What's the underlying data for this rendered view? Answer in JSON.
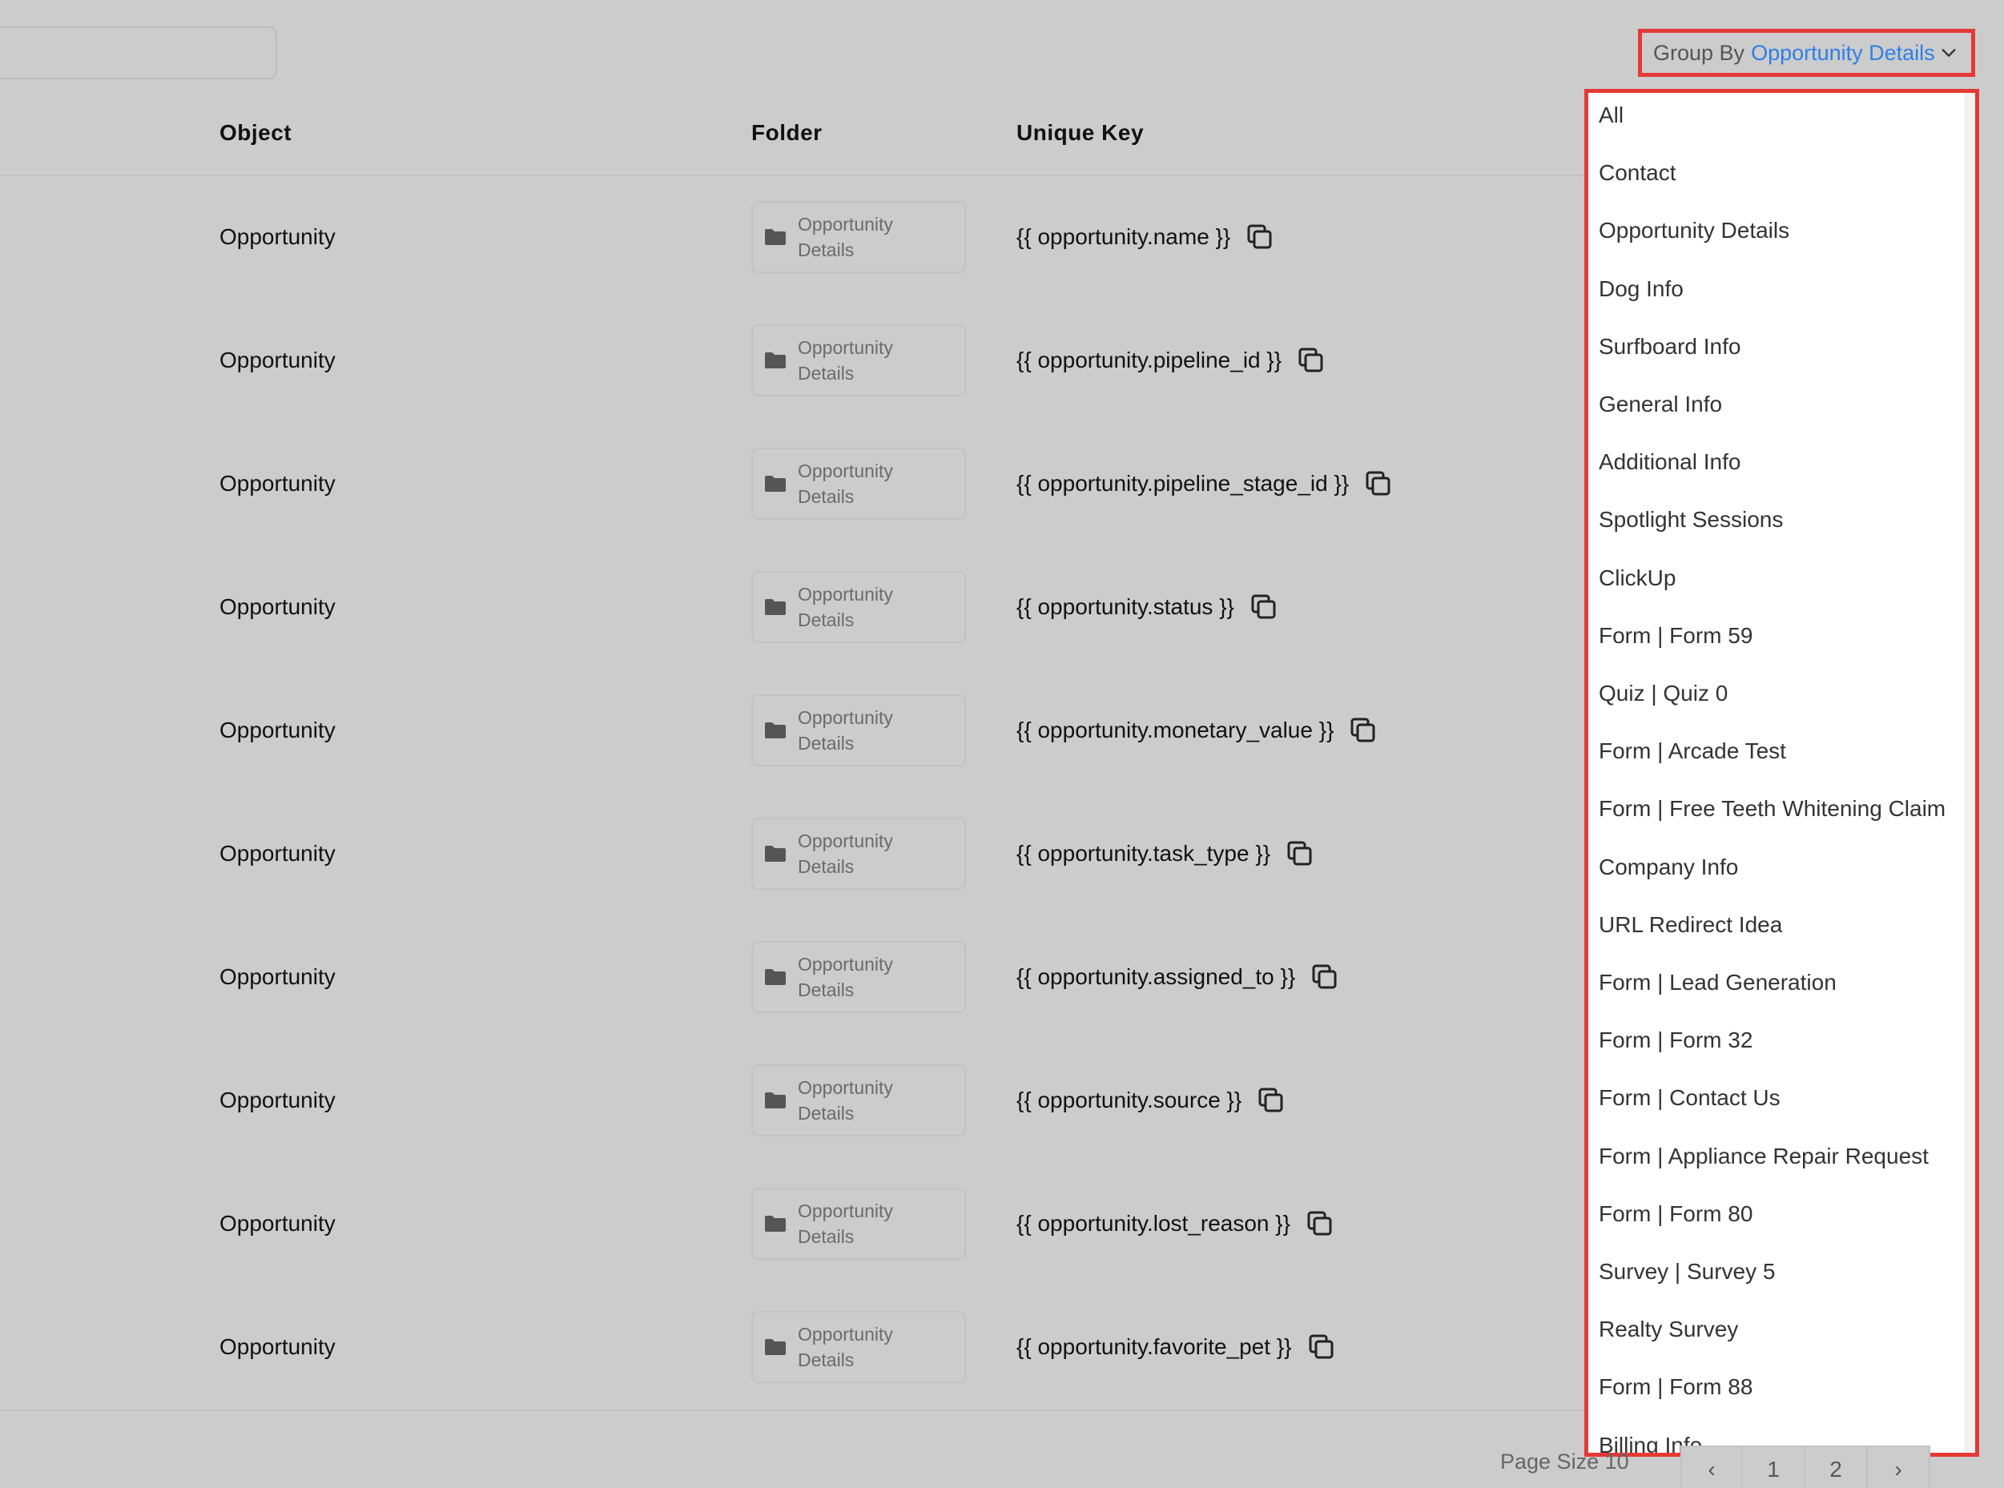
{
  "group_by": {
    "label": "Group By",
    "value": "Opportunity Details"
  },
  "table": {
    "headers": {
      "object": "Object",
      "folder": "Folder",
      "unique_key": "Unique Key"
    },
    "rows": [
      {
        "object": "Opportunity",
        "folder": "Opportunity Details",
        "key": "{{ opportunity.name }}"
      },
      {
        "object": "Opportunity",
        "folder": "Opportunity Details",
        "key": "{{ opportunity.pipeline_id }}"
      },
      {
        "object": "Opportunity",
        "folder": "Opportunity Details",
        "key": "{{ opportunity.pipeline_stage_id }}"
      },
      {
        "object": "Opportunity",
        "folder": "Opportunity Details",
        "key": "{{ opportunity.status }}"
      },
      {
        "object": "Opportunity",
        "folder": "Opportunity Details",
        "key": "{{ opportunity.monetary_value }}"
      },
      {
        "object": "Opportunity",
        "folder": "Opportunity Details",
        "key": "{{ opportunity.task_type }}"
      },
      {
        "object": "Opportunity",
        "folder": "Opportunity Details",
        "key": "{{ opportunity.assigned_to }}"
      },
      {
        "object": "Opportunity",
        "folder": "Opportunity Details",
        "key": "{{ opportunity.source }}"
      },
      {
        "object": "Opportunity",
        "folder": "Opportunity Details",
        "key": "{{ opportunity.lost_reason }}"
      },
      {
        "object": "Opportunity",
        "folder": "Opportunity Details",
        "key": "{{ opportunity.favorite_pet }}"
      }
    ]
  },
  "dropdown": {
    "options": [
      "All",
      "Contact",
      "Opportunity Details",
      "Dog Info",
      "Surfboard Info",
      "General Info",
      "Additional Info",
      "Spotlight Sessions",
      "ClickUp",
      "Form | Form 59",
      "Quiz | Quiz 0",
      "Form | Arcade Test",
      "Form | Free Teeth Whitening Claim",
      "Company Info",
      "URL Redirect Idea",
      "Form | Lead Generation",
      "Form | Form 32",
      "Form | Contact Us",
      "Form | Appliance Repair Request",
      "Form | Form 80",
      "Survey | Survey 5",
      "Realty Survey",
      "Form | Form 88",
      "Billing Info"
    ]
  },
  "pagination": {
    "page_size_label": "Page Size 10",
    "prev": "‹",
    "pages": [
      "1",
      "2"
    ],
    "next": "›"
  },
  "colors": {
    "highlight_border": "#e53935",
    "link_blue": "#2f7fe6",
    "overlay_gray": "#cccccc"
  }
}
